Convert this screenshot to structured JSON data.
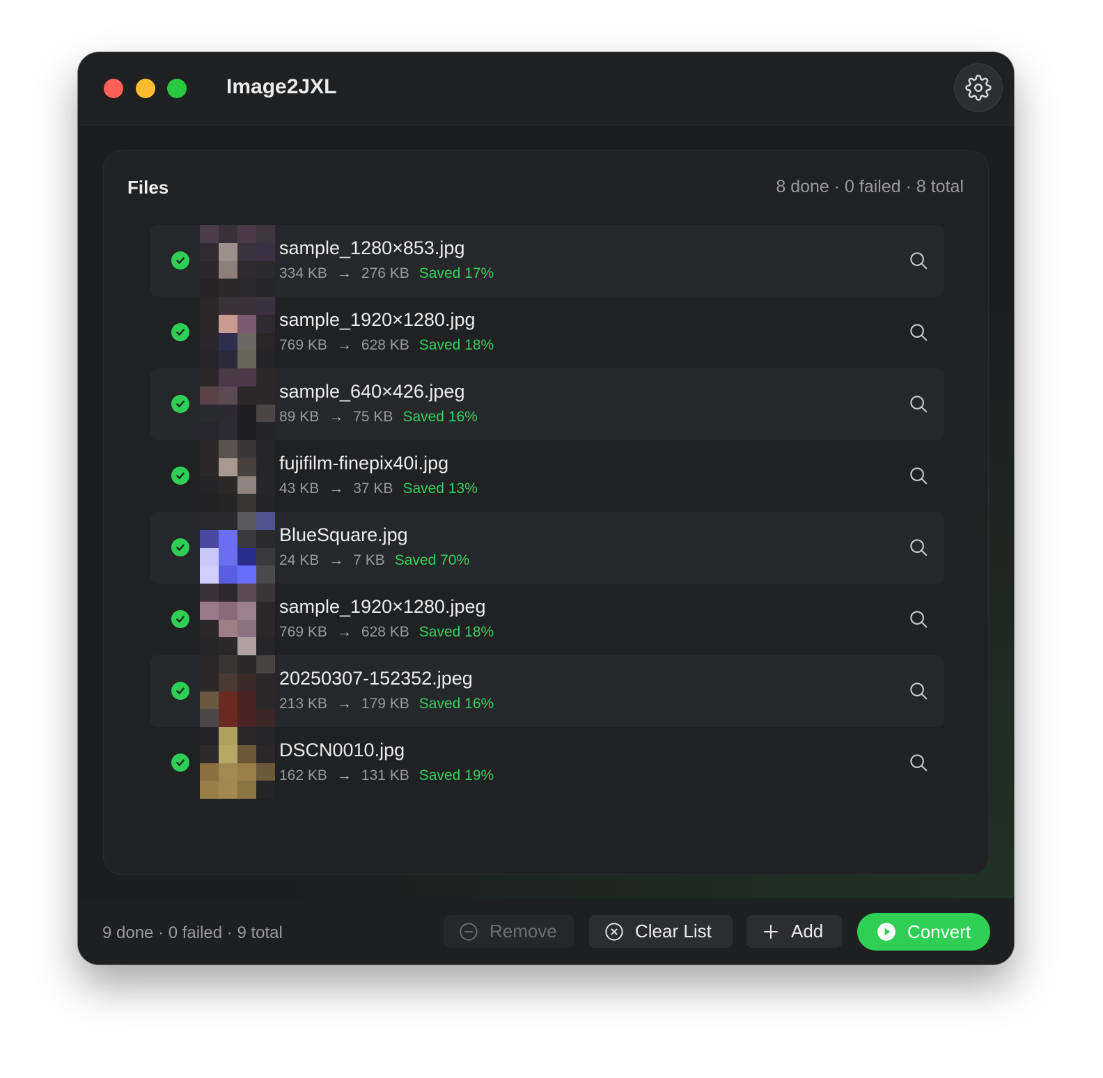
{
  "window": {
    "title": "Image2JXL",
    "settings_icon": "gear-icon"
  },
  "panel": {
    "title": "Files",
    "stats": "8 done · 0 failed · 8 total"
  },
  "files": [
    {
      "name": "sample_1280×853.jpg",
      "original": "334 KB",
      "converted": "276 KB",
      "saved": "Saved 17%",
      "thumb": [
        "#4a3c4a",
        "#3a3039",
        "#4a3a4a",
        "#3e3540",
        "#2f2b30",
        "#9e8f8a",
        "#3b3340",
        "#3a3142",
        "#2a2629",
        "#8e8078",
        "#2e2a30",
        "#2b2a2c",
        "#252326",
        "#2a2829",
        "#2a292b",
        "#262527"
      ]
    },
    {
      "name": "sample_1920×1280.jpg",
      "original": "769 KB",
      "converted": "628 KB",
      "saved": "Saved 18%",
      "thumb": [
        "#2a2729",
        "#3a3038",
        "#3b2f38",
        "#3a3040",
        "#2a2728",
        "#c89a90",
        "#7a5a70",
        "#2f2a30",
        "#2a2629",
        "#2e2e4e",
        "#6e6660",
        "#2a2628",
        "#27252a",
        "#2c2a3a",
        "#6a6458",
        "#252426"
      ]
    },
    {
      "name": "sample_640×426.jpeg",
      "original": "89 KB",
      "converted": "75 KB",
      "saved": "Saved 16%",
      "thumb": [
        "#2c282a",
        "#4a3a48",
        "#4a3a4a",
        "#2a2829",
        "#5a4248",
        "#5a4a52",
        "#2a2829",
        "#2a2829",
        "#2a2a32",
        "#2c2a30",
        "#1e1d1f",
        "#4a4646",
        "#262530",
        "#2c2a34",
        "#1f1e20",
        "#252426"
      ]
    },
    {
      "name": "fujifilm-finepix40i.jpg",
      "original": "43 KB",
      "converted": "37 KB",
      "saved": "Saved 13%",
      "thumb": [
        "#2a2829",
        "#5a524e",
        "#3a3536",
        "#262527",
        "#2a2829",
        "#a89890",
        "#48403e",
        "#262527",
        "#252426",
        "#2a2727",
        "#908480",
        "#262527",
        "#232224",
        "#262525",
        "#3a3535",
        "#252426"
      ]
    },
    {
      "name": "BlueSquare.jpg",
      "original": "24 KB",
      "converted": "7 KB",
      "saved": "Saved 70%",
      "thumb": [
        "#2a2a2c",
        "#2a2a2c",
        "#5a5a5c",
        "#505490",
        "#4a48a0",
        "#6a6ef0",
        "#3a3a3e",
        "#2a2a2c",
        "#c8c8f8",
        "#6a6ef0",
        "#2a2e8a",
        "#3a3a3c",
        "#d0d0fc",
        "#5a5ee0",
        "#6a6eff",
        "#4a4a4c"
      ]
    },
    {
      "name": "sample_1920×1280.jpeg",
      "original": "769 KB",
      "converted": "628 KB",
      "saved": "Saved 18%",
      "thumb": [
        "#3a3236",
        "#2c282e",
        "#5a4a58",
        "#3a3638",
        "#9a7a88",
        "#8a6a78",
        "#9a8090",
        "#2a2829",
        "#2a2829",
        "#a07e88",
        "#8a7280",
        "#2a2829",
        "#262527",
        "#2a2829",
        "#b0a0a0",
        "#262527"
      ]
    },
    {
      "name": "20250307-152352.jpeg",
      "original": "213 KB",
      "converted": "179 KB",
      "saved": "Saved 16%",
      "thumb": [
        "#2a2829",
        "#3a3535",
        "#2a2829",
        "#4a4242",
        "#2a2829",
        "#4a3a34",
        "#3a2a2a",
        "#2a2829",
        "#6a5840",
        "#6a2a22",
        "#4a2222",
        "#2a2829",
        "#4a4848",
        "#6a2a22",
        "#4a2424",
        "#3a2626"
      ]
    },
    {
      "name": "DSCN0010.jpg",
      "original": "162 KB",
      "converted": "131 KB",
      "saved": "Saved 19%",
      "thumb": [
        "#242325",
        "#b0a060",
        "#2a2829",
        "#262527",
        "#2c2a2a",
        "#b8a868",
        "#6a5838",
        "#2a2829",
        "#8a7040",
        "#a08a50",
        "#9a8048",
        "#6a5a3a",
        "#9a7e48",
        "#a08850",
        "#8a7440",
        "#242325"
      ]
    }
  ],
  "footer": {
    "stats": "9 done · 0 failed · 9 total",
    "remove_label": "Remove",
    "clear_label": "Clear List",
    "add_label": "Add",
    "convert_label": "Convert"
  },
  "colors": {
    "accent_green": "#2fce55",
    "saved_text": "#37d05c",
    "traffic_red": "#fe5f57",
    "traffic_yellow": "#febc2e",
    "traffic_green": "#28c840"
  }
}
